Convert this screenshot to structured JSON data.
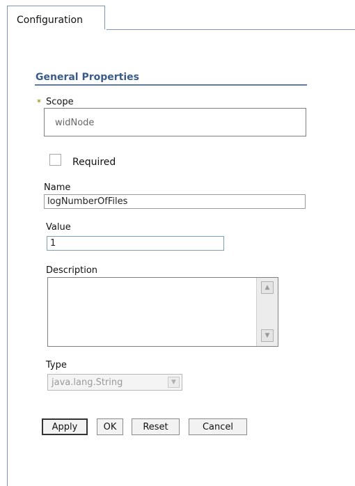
{
  "tabs": [
    {
      "label": "Configuration",
      "active": true
    }
  ],
  "section": {
    "title": "General Properties"
  },
  "form": {
    "scope": {
      "required_mark": "*",
      "label": "Scope",
      "value": "widNode"
    },
    "required": {
      "label": "Required",
      "checked": false
    },
    "name": {
      "label": "Name",
      "value": "logNumberOfFiles"
    },
    "value": {
      "label": "Value",
      "value": "1"
    },
    "description": {
      "label": "Description",
      "value": ""
    },
    "type": {
      "label": "Type",
      "selected": "java.lang.String",
      "disabled": true
    }
  },
  "buttons": {
    "apply": "Apply",
    "ok": "OK",
    "reset": "Reset",
    "cancel": "Cancel"
  },
  "colors": {
    "section_title": "#3a5c8c",
    "border": "#7c96b4",
    "required_star": "#8a7a00"
  }
}
